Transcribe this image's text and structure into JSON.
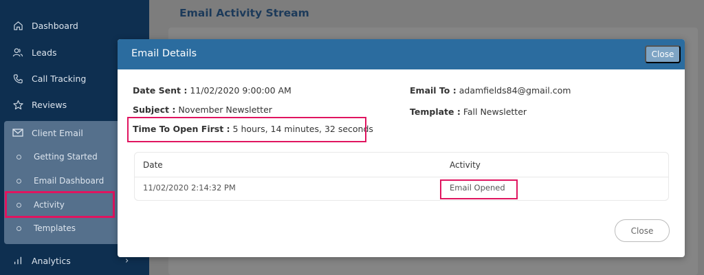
{
  "sidebar": {
    "items": [
      {
        "label": "Dashboard",
        "icon": "home-icon"
      },
      {
        "label": "Leads",
        "icon": "users-icon"
      },
      {
        "label": "Call Tracking",
        "icon": "phone-icon"
      },
      {
        "label": "Reviews",
        "icon": "star-icon"
      },
      {
        "label": "Client Email",
        "icon": "mail-icon"
      }
    ],
    "sub_items": [
      {
        "label": "Getting Started"
      },
      {
        "label": "Email Dashboard"
      },
      {
        "label": "Activity"
      },
      {
        "label": "Templates"
      }
    ],
    "analytics": {
      "label": "Analytics",
      "icon": "bar-chart-icon"
    }
  },
  "page": {
    "title": "Email Activity Stream"
  },
  "modal": {
    "title": "Email Details",
    "header_close": "Close",
    "date_sent_label": "Date Sent :",
    "date_sent": "11/02/2020 9:00:00 AM",
    "email_to_label": "Email To :",
    "email_to": "adamfields84@gmail.com",
    "subject_label": "Subject :",
    "subject": "November Newsletter",
    "template_label": "Template :",
    "template": "Fall Newsletter",
    "time_to_open_label": "Time To Open First :",
    "time_to_open": "5 hours, 14 minutes, 32 seconds",
    "table": {
      "headers": [
        "Date",
        "Activity"
      ],
      "rows": [
        [
          "11/02/2020 2:14:32 PM",
          "Email Opened"
        ]
      ]
    },
    "footer_close": "Close"
  },
  "colors": {
    "sidebar_bg": "#0e2f50",
    "header_bg": "#2b6c9f",
    "highlight": "#e0145f"
  }
}
